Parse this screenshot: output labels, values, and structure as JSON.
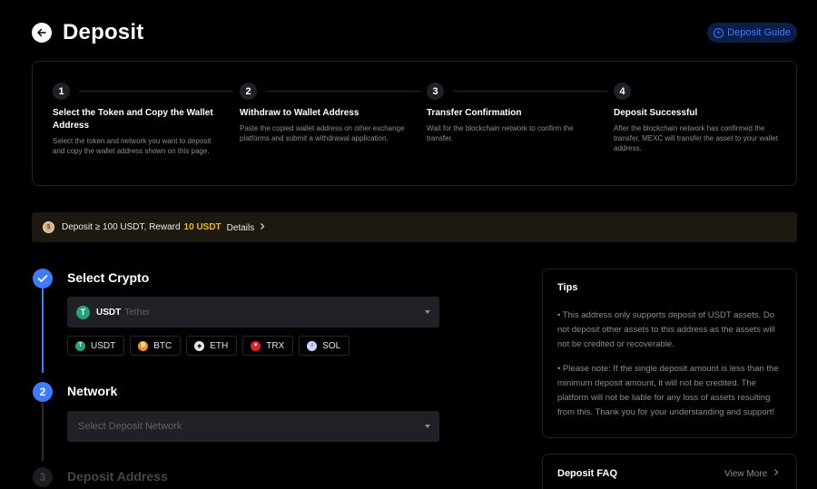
{
  "header": {
    "back_icon": "arrow-left-icon",
    "title": "Deposit",
    "guide_button": "Deposit Guide",
    "guide_icon": "plus-circle-icon"
  },
  "steps": [
    {
      "num": "1",
      "title": "Select the Token and Copy the Wallet Address",
      "desc": "Select the token and network you want to deposit and copy the wallet address shown on this page."
    },
    {
      "num": "2",
      "title": "Withdraw to Wallet Address",
      "desc": "Paste the copied wallet address on other exchange platforms and submit a withdrawal application."
    },
    {
      "num": "3",
      "title": "Transfer Confirmation",
      "desc": "Wait for the blockchain network to confirm the transfer."
    },
    {
      "num": "4",
      "title": "Deposit Successful",
      "desc": "After the blockchain network has confirmed the transfer, MEXC will transfer the asset to your wallet address."
    }
  ],
  "promo": {
    "text": "Deposit ≥ 100 USDT, Reward",
    "reward": "10 USDT",
    "details": "Details"
  },
  "form": {
    "section1": {
      "title": "Select Crypto",
      "selected_symbol": "USDT",
      "selected_name": "Tether",
      "chips": [
        {
          "label": "USDT",
          "color": "#26a17b",
          "glyph": "T"
        },
        {
          "label": "BTC",
          "color": "#f7931a",
          "glyph": "₿"
        },
        {
          "label": "ETH",
          "color": "#e6e6e6",
          "glyph": "◆"
        },
        {
          "label": "TRX",
          "color": "#e0202a",
          "glyph": "▼"
        },
        {
          "label": "SOL",
          "color": "#cfd6ff",
          "glyph": "≡"
        }
      ]
    },
    "section2": {
      "num": "2",
      "title": "Network",
      "placeholder": "Select Deposit Network"
    },
    "section3": {
      "num": "3",
      "title": "Deposit Address"
    }
  },
  "tips": {
    "title": "Tips",
    "items": [
      "• This address only supports deposit of USDT assets. Do not deposit other assets to this address as the assets will not be credited or recoverable.",
      "• Please note: If the single deposit amount is less than the minimum deposit amount, it will not be credited. The platform will not be liable for any loss of assets resulting from this. Thank you for your understanding and support!"
    ]
  },
  "faq": {
    "title": "Deposit FAQ",
    "view_more": "View More"
  },
  "colors": {
    "accent": "#3f7bff",
    "reward": "#f0b90b",
    "panel": "#1f2126"
  }
}
